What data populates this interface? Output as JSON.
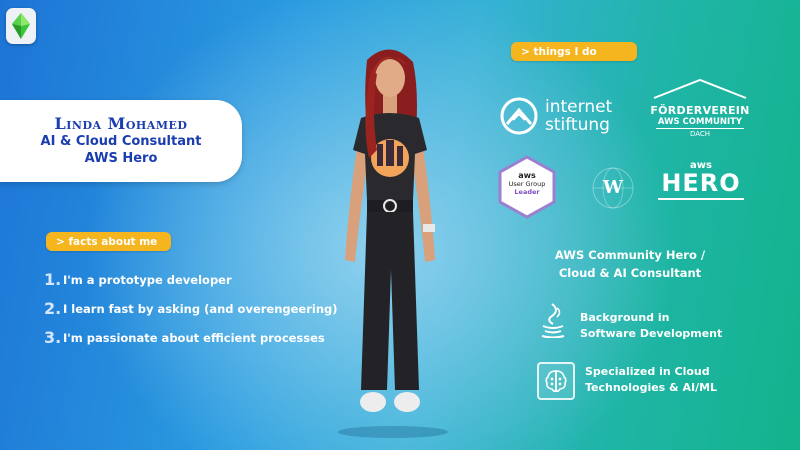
{
  "profile": {
    "name": "Linda Mohamed",
    "role": "AI & Cloud Consultant",
    "title": "AWS Hero"
  },
  "facts": {
    "label": "> facts about me",
    "items": [
      {
        "num": "1.",
        "text": "I'm a prototype developer"
      },
      {
        "num": "2.",
        "text": "I learn fast by asking (and overengeering)"
      },
      {
        "num": "3.",
        "text": "I'm passionate about efficient processes"
      }
    ]
  },
  "things": {
    "label": "> things I do",
    "logos": {
      "internet_stiftung": [
        "internet",
        "stiftung"
      ],
      "foerderverein": [
        "FÖRDERVEREIN",
        "AWS COMMUNITY",
        "DACH"
      ],
      "ug_badge": {
        "brand": "aws",
        "line1": "User Group",
        "line2": "Leader"
      },
      "w_logo": "W",
      "aws_hero": {
        "brand": "aws",
        "word": "HERO"
      }
    }
  },
  "summary": [
    "AWS Community Hero /",
    "Cloud & AI Consultant"
  ],
  "features": [
    {
      "icon": "java-icon",
      "lines": [
        "Background in",
        "Software Development"
      ]
    },
    {
      "icon": "ai-brain-icon",
      "lines": [
        "Specialized in Cloud",
        "Technologies & AI/ML"
      ]
    }
  ],
  "colors": {
    "accent": "#f5b51e",
    "name": "#1a3db0"
  }
}
